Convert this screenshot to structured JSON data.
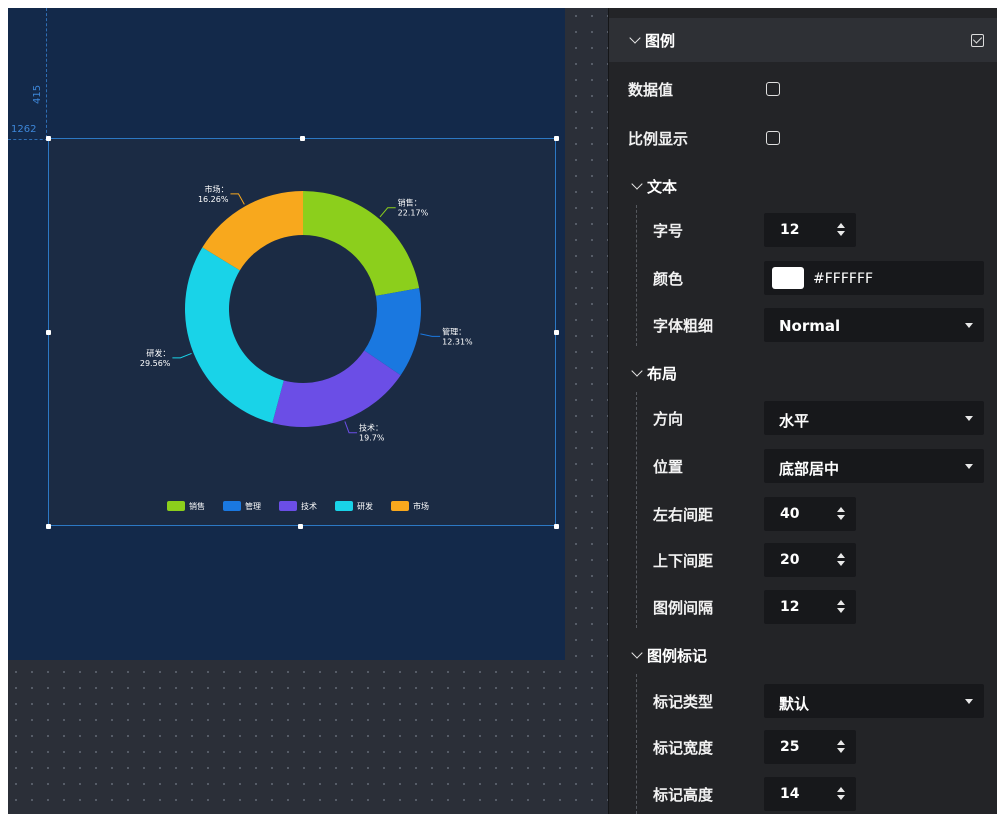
{
  "canvas": {
    "ruler_x": "1262",
    "ruler_y": "415"
  },
  "chart_data": {
    "type": "pie",
    "donut": true,
    "categories": [
      "销售",
      "管理",
      "技术",
      "研发",
      "市场"
    ],
    "values": [
      22.17,
      12.31,
      19.7,
      29.56,
      16.26
    ],
    "labels": [
      "22.17%",
      "12.31%",
      "19.7%",
      "29.56%",
      "16.26%"
    ],
    "colors": [
      "#8ccf1c",
      "#1a78e0",
      "#6b4ee6",
      "#19d3e8",
      "#f8a81d"
    ],
    "legend_position": "bottom-center",
    "label_suffix": "："
  },
  "panel": {
    "legend_section": {
      "title": "图例",
      "enabled": true
    },
    "data_value": {
      "label": "数据值",
      "checked": false
    },
    "ratio_display": {
      "label": "比例显示",
      "checked": false
    },
    "text_group": {
      "title": "文本",
      "font_size": {
        "label": "字号",
        "value": "12"
      },
      "color": {
        "label": "颜色",
        "value": "#FFFFFF",
        "swatch": "#ffffff"
      },
      "font_weight": {
        "label": "字体粗细",
        "value": "Normal"
      }
    },
    "layout_group": {
      "title": "布局",
      "direction": {
        "label": "方向",
        "value": "水平"
      },
      "position": {
        "label": "位置",
        "value": "底部居中"
      },
      "h_spacing": {
        "label": "左右间距",
        "value": "40"
      },
      "v_spacing": {
        "label": "上下间距",
        "value": "20"
      },
      "legend_gap": {
        "label": "图例间隔",
        "value": "12"
      }
    },
    "marker_group": {
      "title": "图例标记",
      "marker_type": {
        "label": "标记类型",
        "value": "默认"
      },
      "marker_width": {
        "label": "标记宽度",
        "value": "25"
      },
      "marker_height": {
        "label": "标记高度",
        "value": "14"
      }
    }
  }
}
